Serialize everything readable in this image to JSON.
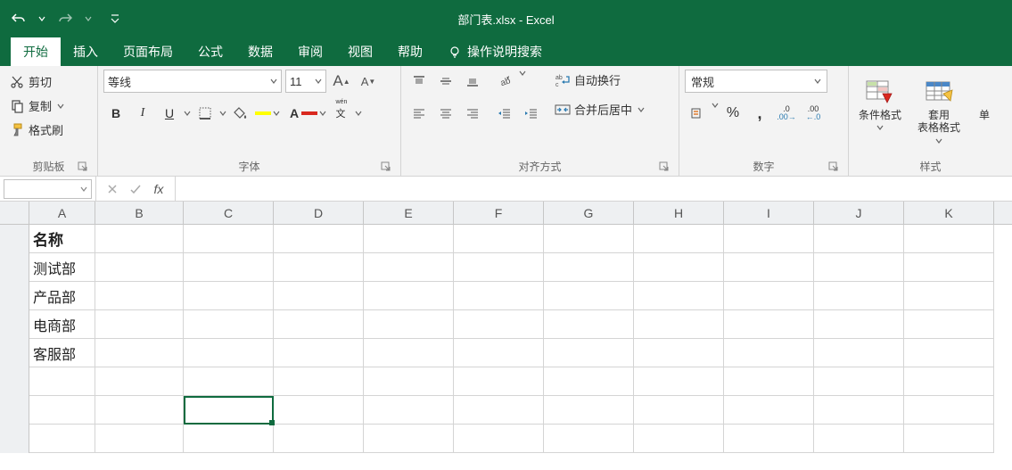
{
  "title": "部门表.xlsx - Excel",
  "qat": {
    "undo": "undo",
    "redo": "redo"
  },
  "tabs": {
    "file_glyph": "",
    "home": "开始",
    "insert": "插入",
    "page_layout": "页面布局",
    "formulas": "公式",
    "data": "数据",
    "review": "审阅",
    "view": "视图",
    "help": "帮助",
    "tell_me": "操作说明搜索"
  },
  "clipboard": {
    "cut": "剪切",
    "copy": "复制",
    "format_painter": "格式刷",
    "group_label": "剪贴板"
  },
  "font": {
    "name": "等线",
    "size": "11",
    "group_label": "字体"
  },
  "alignment": {
    "wrap": "自动换行",
    "merge": "合并后居中",
    "group_label": "对齐方式"
  },
  "number": {
    "format": "常规",
    "group_label": "数字"
  },
  "styles": {
    "cond_fmt_1": "条件格式",
    "cond_fmt_2": "",
    "table_fmt_1": "套用",
    "table_fmt_2": "表格格式",
    "cell_styles": "单",
    "group_label": "样式"
  },
  "formula_bar": {
    "name_box": "",
    "fx": "fx",
    "formula": ""
  },
  "grid": {
    "columns": [
      "A",
      "B",
      "C",
      "D",
      "E",
      "F",
      "G",
      "H",
      "I",
      "J",
      "K"
    ],
    "data": {
      "A1": "名称",
      "A2": "测试部",
      "A3": "产品部",
      "A4": "电商部",
      "A5": "客服部"
    }
  }
}
